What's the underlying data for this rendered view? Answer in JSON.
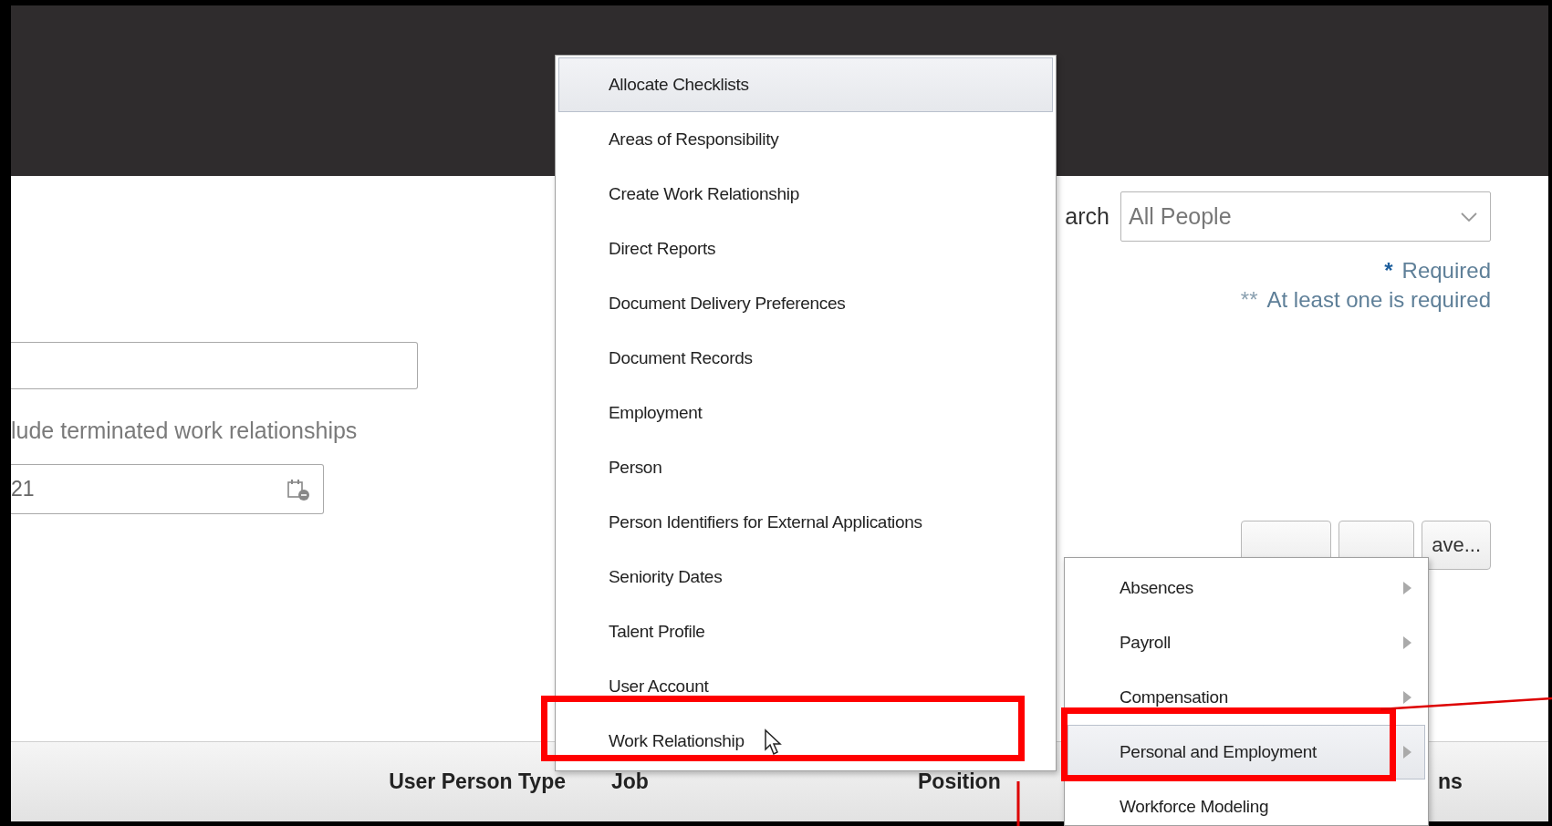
{
  "search_form": {
    "terminated_note": "lude terminated work relationships",
    "date_field": {
      "value": "21"
    },
    "search_label": "arch",
    "search_select": {
      "value": "All People"
    },
    "legend": [
      {
        "mark": "*",
        "text": "Required"
      },
      {
        "mark": "**",
        "text": "At least one is required"
      }
    ],
    "buttons": [
      {
        "kind": "covered"
      },
      {
        "kind": "covered"
      },
      {
        "kind": "labeled",
        "label": "ave..."
      }
    ]
  },
  "actions_menu": {
    "items": [
      {
        "label": "Allocate Checklists",
        "selected": true
      },
      {
        "label": "Areas of Responsibility",
        "selected": false
      },
      {
        "label": "Create Work Relationship",
        "selected": false
      },
      {
        "label": "Direct Reports",
        "selected": false
      },
      {
        "label": "Document Delivery Preferences",
        "selected": false
      },
      {
        "label": "Document Records",
        "selected": false
      },
      {
        "label": "Employment",
        "selected": false
      },
      {
        "label": "Person",
        "selected": false
      },
      {
        "label": "Person Identifiers for External Applications",
        "selected": false
      },
      {
        "label": "Seniority Dates",
        "selected": false
      },
      {
        "label": "Talent Profile",
        "selected": false
      },
      {
        "label": "User Account",
        "selected": false
      },
      {
        "label": "Work Relationship",
        "selected": false
      }
    ]
  },
  "submenu": {
    "items": [
      {
        "label": "Absences",
        "selected": false,
        "has_submenu": true
      },
      {
        "label": "Payroll",
        "selected": false,
        "has_submenu": true
      },
      {
        "label": "Compensation",
        "selected": false,
        "has_submenu": true
      },
      {
        "label": "Personal and Employment",
        "selected": true,
        "has_submenu": true
      },
      {
        "label": "Workforce Modeling",
        "selected": false,
        "has_submenu": false
      }
    ]
  },
  "table": {
    "columns": [
      "User Person Type",
      "Job",
      "Position",
      "ns"
    ]
  }
}
